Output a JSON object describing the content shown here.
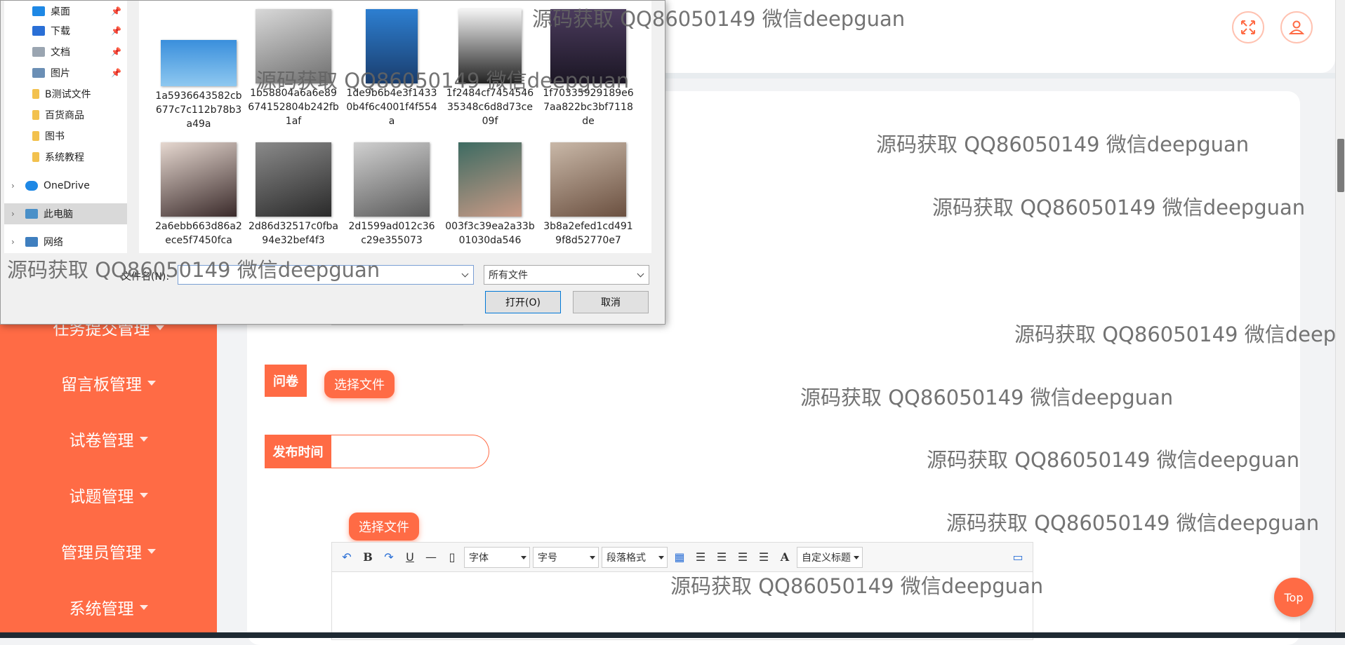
{
  "sidebar": {
    "items": [
      {
        "label": "任务提交管理"
      },
      {
        "label": "留言板管理"
      },
      {
        "label": "试卷管理"
      },
      {
        "label": "试题管理"
      },
      {
        "label": "管理员管理"
      },
      {
        "label": "系统管理"
      }
    ]
  },
  "topbar": {
    "fullscreen_icon": "fullscreen-icon",
    "user_icon": "user-icon"
  },
  "form": {
    "questionnaire_label": "问卷",
    "select_file_label": "选择文件",
    "publish_time_label": "发布时间",
    "publish_time_value": "",
    "select_file_label_2": "选择文件"
  },
  "editor": {
    "font_family": "字体",
    "font_size": "字号",
    "paragraph_format": "段落格式",
    "custom_title": "自定义标题",
    "bold_label": "B",
    "underline_label": "U",
    "font_color_label": "A"
  },
  "back_to_top": "Top",
  "watermark_text": "源码获取 QQ86050149 微信deepguan",
  "dialog": {
    "nav": [
      {
        "label": "桌面",
        "pinned": true
      },
      {
        "label": "下载",
        "pinned": true
      },
      {
        "label": "文档",
        "pinned": true
      },
      {
        "label": "图片",
        "pinned": true
      },
      {
        "label": "B测试文件"
      },
      {
        "label": "百货商品"
      },
      {
        "label": "图书"
      },
      {
        "label": "系统教程"
      },
      {
        "label": "OneDrive"
      },
      {
        "label": "此电脑"
      },
      {
        "label": "网络"
      }
    ],
    "files": [
      {
        "name": "1a5936643582cb677c7c112b78b3a49a"
      },
      {
        "name": "1b58804a6a6e89674152804b242fb1af"
      },
      {
        "name": "1de9b6b4e3f14330b4f6c4001f4f554a"
      },
      {
        "name": "1f2484cf745454635348c6d8d73ce09f"
      },
      {
        "name": "1f70335929189e67aa822bc3bf7118de"
      },
      {
        "name": "2a6ebb663d86a2ece5f7450fca"
      },
      {
        "name": "2d86d32517c0fba94e32bef4f3"
      },
      {
        "name": "2d1599ad012c36c29e355073"
      },
      {
        "name": "003f3c39ea2a33b01030da546"
      },
      {
        "name": "3b8a2efed1cd4919f8d52770e7"
      }
    ],
    "filename_label": "文件名(N):",
    "filename_value": "",
    "filetype_value": "所有文件",
    "open_button": "打开(O)",
    "cancel_button": "取消"
  },
  "colors": {
    "accent": "#ff6b45",
    "accent_light": "#ffc2b1",
    "dialog_bg": "#f0f0f0"
  }
}
